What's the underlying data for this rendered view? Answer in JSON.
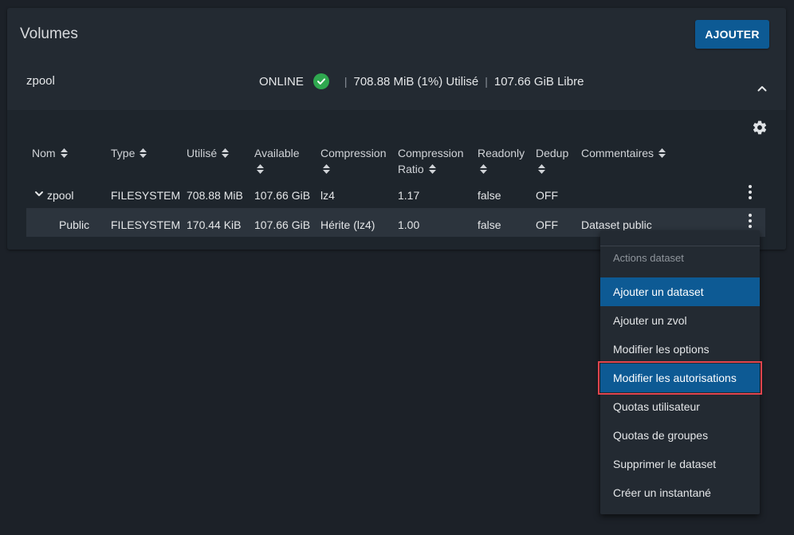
{
  "panel": {
    "title": "Volumes",
    "add_label": "AJOUTER"
  },
  "pool": {
    "name": "zpool",
    "status": "ONLINE",
    "used": "708.88 MiB (1%) Utilisé",
    "free": "107.66 GiB Libre",
    "separator": "|"
  },
  "table": {
    "headers": [
      {
        "line1": "Nom",
        "line2": ""
      },
      {
        "line1": "Type",
        "line2": ""
      },
      {
        "line1": "Utilisé",
        "line2": ""
      },
      {
        "line1": "Available",
        "line2": ""
      },
      {
        "line1": "Compression",
        "line2": ""
      },
      {
        "line1": "Compression",
        "line2": "Ratio"
      },
      {
        "line1": "Readonly",
        "line2": ""
      },
      {
        "line1": "Dedup",
        "line2": ""
      },
      {
        "line1": "Commentaires",
        "line2": ""
      }
    ],
    "rows": [
      {
        "name": "zpool",
        "type": "FILESYSTEM",
        "used": "708.88 MiB",
        "available": "107.66 GiB",
        "compression": "lz4",
        "ratio": "1.17",
        "readonly": "false",
        "dedup": "OFF",
        "comment": ""
      },
      {
        "name": "Public",
        "type": "FILESYSTEM",
        "used": "170.44 KiB",
        "available": "107.66 GiB",
        "compression": "Hérite (lz4)",
        "ratio": "1.00",
        "readonly": "false",
        "dedup": "OFF",
        "comment": "Dataset public"
      }
    ]
  },
  "menu": {
    "heading": "Actions dataset",
    "items": [
      "Ajouter un dataset",
      "Ajouter un zvol",
      "Modifier les options",
      "Modifier les autorisations",
      "Quotas utilisateur",
      "Quotas de groupes",
      "Supprimer le dataset",
      "Créer un instantané"
    ]
  },
  "colors": {
    "accent": "#0d5a94",
    "status_ok": "#2fa84f",
    "highlight_outline": "#e0444d"
  }
}
